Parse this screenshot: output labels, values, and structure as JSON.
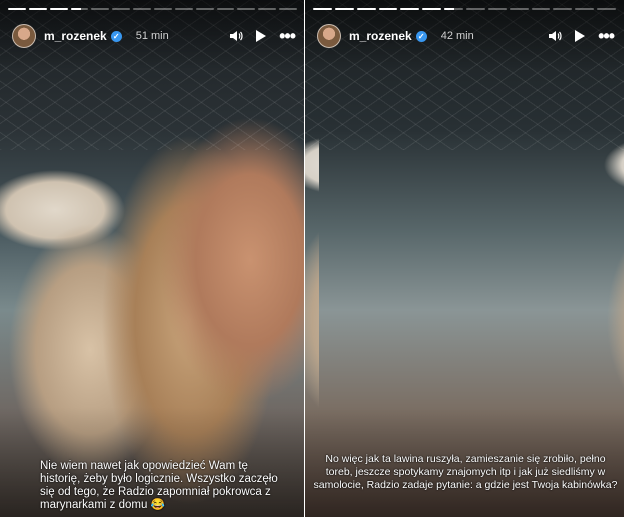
{
  "stories": [
    {
      "id": "left",
      "progress": [
        1,
        1,
        1,
        0.6,
        0,
        0,
        0,
        0,
        0,
        0,
        0,
        0,
        0,
        0
      ],
      "username": "m_rozenek",
      "verified_badge": "✓",
      "time_ago": "51 min",
      "icons": {
        "sound": "speaker-icon",
        "play": "play-icon",
        "more": "more-icon"
      },
      "caption": "Nie wiem nawet jak opowiedzieć Wam tę historię, żeby było logicznie.  Wszystko zaczęło się od tego, że Radzio zapomniał pokrowca z marynarkami z domu 😂"
    },
    {
      "id": "right",
      "progress": [
        1,
        1,
        1,
        1,
        1,
        1,
        0.5,
        0,
        0,
        0,
        0,
        0,
        0,
        0
      ],
      "username": "m_rozenek",
      "verified_badge": "✓",
      "time_ago": "42 min",
      "icons": {
        "sound": "speaker-icon",
        "play": "play-icon",
        "more": "more-icon"
      },
      "caption": "No więc jak ta lawina ruszyła, zamieszanie się zrobiło, pełno toreb, jeszcze spotykamy znajomych itp i jak już siedliśmy w samolocie, Radzio zadaje pytanie: a gdzie jest Twoja kabinówka?"
    }
  ],
  "colors": {
    "verified": "#3897f0",
    "text": "#ffffff"
  }
}
